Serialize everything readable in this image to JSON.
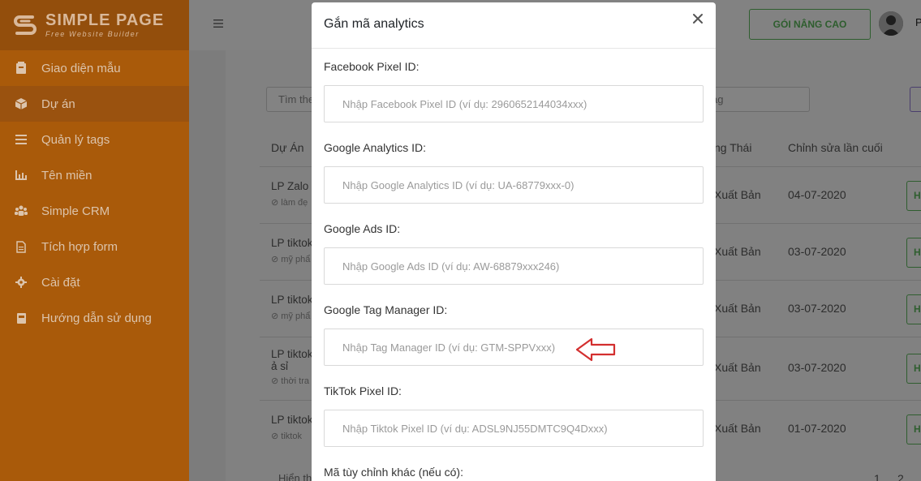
{
  "brand": {
    "name": "SIMPLE PAGE",
    "tagline": "Free Website Builder"
  },
  "sidebar": {
    "items": [
      {
        "label": "Giao diện mẫu",
        "icon": "template-icon"
      },
      {
        "label": "Dự án",
        "icon": "cube-icon",
        "active": true
      },
      {
        "label": "Quản lý tags",
        "icon": "list-icon"
      },
      {
        "label": "Tên miền",
        "icon": "bar-chart-icon"
      },
      {
        "label": "Simple CRM",
        "icon": "users-icon"
      },
      {
        "label": "Tích hợp form",
        "icon": "document-icon"
      },
      {
        "label": "Cài đặt",
        "icon": "gear-icon"
      },
      {
        "label": "Hướng dẫn sử dụng",
        "icon": "book-icon"
      }
    ]
  },
  "topbar": {
    "upgrade_label": "GÓI NÂNG CAO",
    "user_initial": "P"
  },
  "main": {
    "search_placeholder": "Tìm the",
    "tag_placeholder": "ag",
    "columns": {
      "project": "Dự Án",
      "status": "ng Thái",
      "last_edit": "Chỉnh sửa lần cuối"
    },
    "rows": [
      {
        "title": "LP Zalo",
        "tag": "làm đẹ",
        "status": "Xuất Bản",
        "date": "04-07-2020",
        "action": "H"
      },
      {
        "title": "LP tiktok",
        "tag": "mỹ phẩ",
        "status": "Xuất Bản",
        "date": "03-07-2020",
        "action": "H"
      },
      {
        "title": "LP tiktok",
        "tag": "mỹ phẩ",
        "status": "Xuất Bản",
        "date": "03-07-2020",
        "action": "H"
      },
      {
        "title": "LP tiktok",
        "title2": "ả sỉ",
        "tag": "thời tra",
        "status": "Xuất Bản",
        "date": "03-07-2020",
        "action": "H"
      },
      {
        "title": "LP tiktok",
        "tag": "tiktok",
        "status": "Xuất Bản",
        "date": "01-07-2020",
        "action": "H"
      }
    ],
    "footer_text": "Hiển th",
    "pages": [
      "1",
      "2"
    ]
  },
  "modal": {
    "title": "Gắn mã analytics",
    "close_icon": "close-icon",
    "fields": [
      {
        "label": "Facebook Pixel ID:",
        "placeholder": "Nhập Facebook Pixel ID (ví dụ: 2960652144034xxx)"
      },
      {
        "label": "Google Analytics ID:",
        "placeholder": "Nhập Google Analytics ID (ví dụ: UA-68779xxx-0)"
      },
      {
        "label": "Google Ads ID:",
        "placeholder": "Nhập Google Ads ID (ví dụ: AW-68879xxx246)"
      },
      {
        "label": "Google Tag Manager ID:",
        "placeholder": "Nhập Tag Manager ID (ví dụ: GTM-SPPVxxx)"
      },
      {
        "label": "TikTok Pixel ID:",
        "placeholder": "Nhập Tiktok Pixel ID (ví dụ: ADSL9NJ55DMTC9Q4Dxxx)"
      }
    ],
    "custom_code_label": "Mã tùy chỉnh khác (nếu có):"
  },
  "colors": {
    "annotation_arrow": "#d32f2f",
    "sidebar_bg": "#a95a0a",
    "upgrade_border": "#2f5e2f"
  }
}
